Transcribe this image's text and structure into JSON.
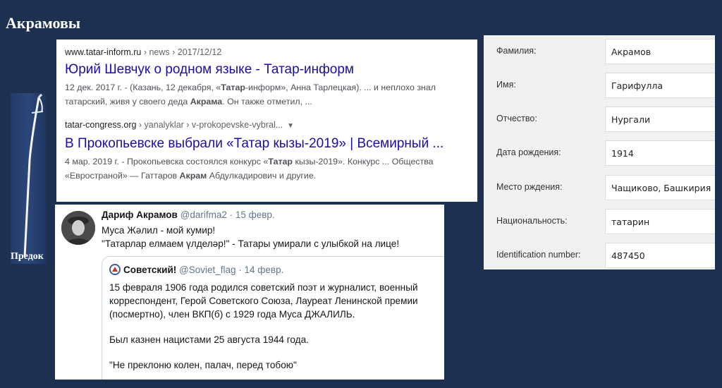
{
  "page": {
    "title": "Акрамовы"
  },
  "ancestor": {
    "caption": "Предок"
  },
  "search_results": [
    {
      "site": "www.tatar-inform.ru",
      "crumbs": " › news › 2017/12/12",
      "title": "Юрий Шевчук о родном языке - Татар-информ",
      "snippet_lines": [
        [
          {
            "t": "12 дек. 2017 г. - (Казань, 12 декабря, «",
            "b": false
          },
          {
            "t": "Татар",
            "b": true
          },
          {
            "t": "-информ», Анна Тарлецкая). ... и неплохо знал",
            "b": false
          }
        ],
        [
          {
            "t": "татарский, живя у своего деда ",
            "b": false
          },
          {
            "t": "Акрама",
            "b": true
          },
          {
            "t": ". Он также отметил, ...",
            "b": false
          }
        ]
      ]
    },
    {
      "site": "tatar-congress.org",
      "crumbs": " › yanalyklar › v-prokopevske-vybral...",
      "dropdown": "▼",
      "title": "В Прокопьевске выбрали «Татар кызы-2019» | Всемирный ...",
      "snippet_lines": [
        [
          {
            "t": "4 мар. 2019 г. - Прокопьевска состоялся конкурс «",
            "b": false
          },
          {
            "t": "Татар",
            "b": true
          },
          {
            "t": " кызы-2019». Конкурс ... Общества",
            "b": false
          }
        ],
        [
          {
            "t": "«Евространой» — Гаттаров ",
            "b": false
          },
          {
            "t": "Акрам",
            "b": true
          },
          {
            "t": " Абдулкадирович и другие.",
            "b": false
          }
        ]
      ]
    }
  ],
  "tweet": {
    "author_name": "Дариф Акрамов",
    "handle": "@darifma2",
    "sep": " · ",
    "date": "15 февр.",
    "lines": [
      "Муса Жәлил - мой кумир!",
      "\"Татарлар елмаем үлделәр!\" - Татары умирали с улыбкой на лице!"
    ],
    "quote": {
      "author_name": "Советский!",
      "handle": "@Soviet_flag",
      "sep": " · ",
      "date": "14 февр.",
      "paragraphs": [
        [
          "15 февраля 1906 года родился советский поэт и журналист, военный",
          "корреспондент, Герой Советского Союза, Лауреат Ленинской премии",
          "(посмертно), член ВКП(б) с 1929 года Муса ДЖАЛИЛЬ."
        ],
        [
          "Был казнен нацистами 25 августа 1944 года."
        ],
        [
          "\"Не преклоню колен, палач, перед тобою\""
        ]
      ]
    }
  },
  "profile": {
    "fields": [
      {
        "label": "Фамилия:",
        "value": "Акрамов"
      },
      {
        "label": "Имя:",
        "value": "Гарифулла"
      },
      {
        "label": "Отчество:",
        "value": "Нургали"
      },
      {
        "label": "Дата рождения:",
        "value": "1914"
      },
      {
        "label": "Место рждения:",
        "value": "Чащиково, Башкирия"
      },
      {
        "label": "Национальность:",
        "value": "татарин"
      },
      {
        "label": "Identification number:",
        "value": "487450"
      }
    ]
  }
}
